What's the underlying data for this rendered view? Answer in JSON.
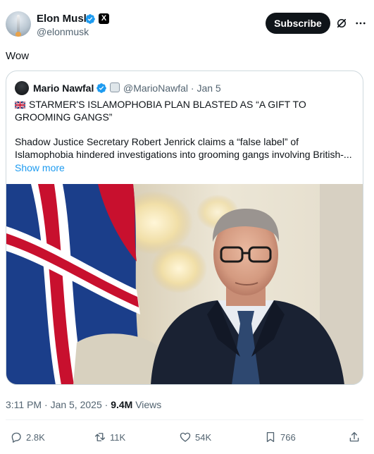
{
  "author": {
    "name": "Elon Musk",
    "handle": "@elonmusk",
    "verified_color": "#1d9bf0",
    "affiliate_badge": "X"
  },
  "header": {
    "subscribe_label": "Subscribe",
    "grok_icon": "grok-icon",
    "more_icon": "more-icon"
  },
  "post": {
    "text": "Wow"
  },
  "quote": {
    "name": "Mario Nawfal",
    "handle": "@MarioNawfal",
    "separator": "·",
    "date": "Jan 5",
    "headline": "STARMER'S ISLAMOPHOBIA PLAN BLASTED AS “A GIFT TO GROOMING GANGS”",
    "body_line1": "Shadow Justice Secretary Robert Jenrick claims a “false label” of",
    "body_line2": "Islamophobia hindered investigations into grooming gangs involving British-...",
    "show_more": "Show more"
  },
  "meta": {
    "time": "3:11 PM",
    "dot1": "·",
    "date": "Jan 5, 2025",
    "dot2": "·",
    "views_count": "9.4M",
    "views_label": "Views"
  },
  "actions": {
    "replies": "2.8K",
    "reposts": "11K",
    "likes": "54K",
    "bookmarks": "766"
  },
  "colors": {
    "text": "#0f1419",
    "secondary": "#536471",
    "link": "#1d9bf0",
    "border": "#cfd9de"
  }
}
